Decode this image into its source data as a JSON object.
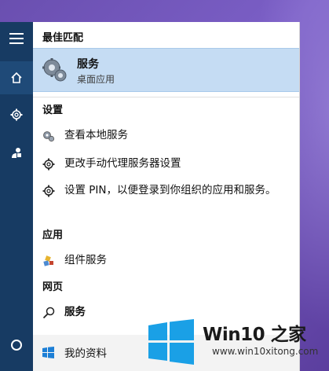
{
  "rail": {
    "menu_icon": "hamburger-icon",
    "home_icon": "home-icon",
    "settings_icon": "gear-icon",
    "user_icon": "user-icon",
    "cortana_icon": "cortana-circle-icon"
  },
  "panel": {
    "best_match": {
      "header": "最佳匹配",
      "title": "服务",
      "subtitle": "桌面应用",
      "icon": "gears-icon"
    },
    "settings": {
      "header": "设置",
      "items": [
        {
          "label": "查看本地服务",
          "icon": "gears-small-icon"
        },
        {
          "label": "更改手动代理服务器设置",
          "icon": "gear-icon"
        },
        {
          "label": "设置 PIN，以便登录到你组织的应用和服务。",
          "icon": "gear-icon"
        }
      ]
    },
    "apps": {
      "header": "应用",
      "items": [
        {
          "label": "组件服务",
          "icon": "component-services-icon"
        }
      ]
    },
    "web": {
      "header": "网页",
      "items": [
        {
          "label": "服务",
          "icon": "search-icon"
        }
      ]
    },
    "my_stuff": {
      "label": "我的资料",
      "icon": "windows-logo-icon"
    }
  },
  "watermark": {
    "brand": "Win10 之家",
    "url": "www.win10xitong.com",
    "colors": {
      "logo": "#1aa0e6"
    }
  }
}
